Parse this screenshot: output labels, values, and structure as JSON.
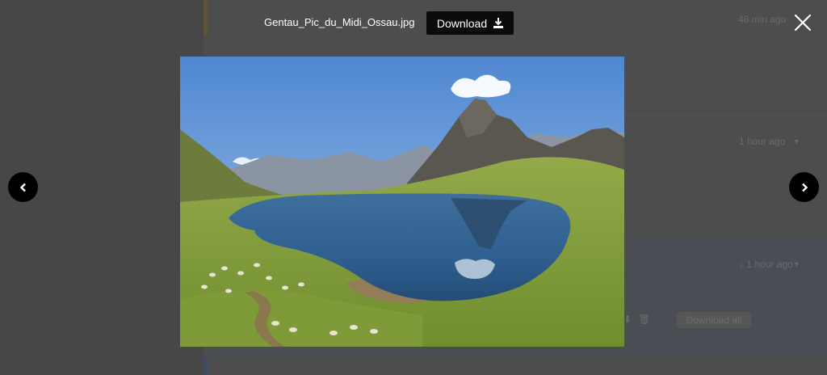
{
  "background_page": {
    "items": [
      {
        "time": "48 min ago"
      },
      {
        "time": "1 hour ago"
      },
      {
        "time": "1 hour ago"
      }
    ],
    "download_all_label": "Download all"
  },
  "viewer": {
    "filename": "Gentau_Pic_du_Midi_Ossau.jpg",
    "download_label": "Download",
    "icons": {
      "download": "download-icon",
      "close": "close-icon",
      "prev": "chevron-left-icon",
      "next": "chevron-right-icon"
    }
  },
  "colors": {
    "overlay": "#4a4a4a",
    "button": "#0b0b0b",
    "text": "#ffffff"
  }
}
